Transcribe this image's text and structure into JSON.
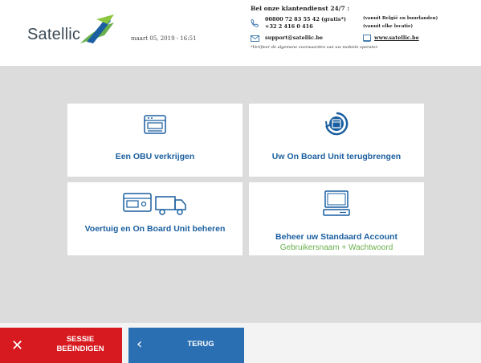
{
  "header": {
    "logo_text": "Satellic",
    "datetime": "maart 05, 2019 - 16:51",
    "contact": {
      "title": "Bel onze klantendienst 24/7 :",
      "phone1": "00800 72 83 55 42 (gratis*)",
      "phone1_note": "(vanuit België en buurlanden)",
      "phone2": "+32 2 416 0 416",
      "phone2_note": "(vanuit elke locatie)",
      "email": "support@satellic.be",
      "website": "www.satellic.be",
      "disclaimer": "*Verifieer de algemene voorwaarden van uw mobiele operator."
    }
  },
  "tiles": [
    {
      "label": "Een OBU verkrijgen",
      "icon": "obu-device-icon"
    },
    {
      "label": "Uw On Board Unit terugbrengen",
      "icon": "return-obu-icon"
    },
    {
      "label": "Voertuig en On Board Unit beheren",
      "icon": "obu-truck-icon"
    },
    {
      "label": "Beheer uw Standaard Account",
      "sub": "Gebruikersnaam + Wachtwoord",
      "icon": "computer-icon"
    }
  ],
  "footer": {
    "end_session": "SESSIE BEËINDIGEN",
    "back": "TERUG"
  },
  "colors": {
    "primary_blue": "#1a5fa0",
    "green": "#6ab04c",
    "red": "#d71a1f",
    "back_blue": "#2a6fb2"
  }
}
